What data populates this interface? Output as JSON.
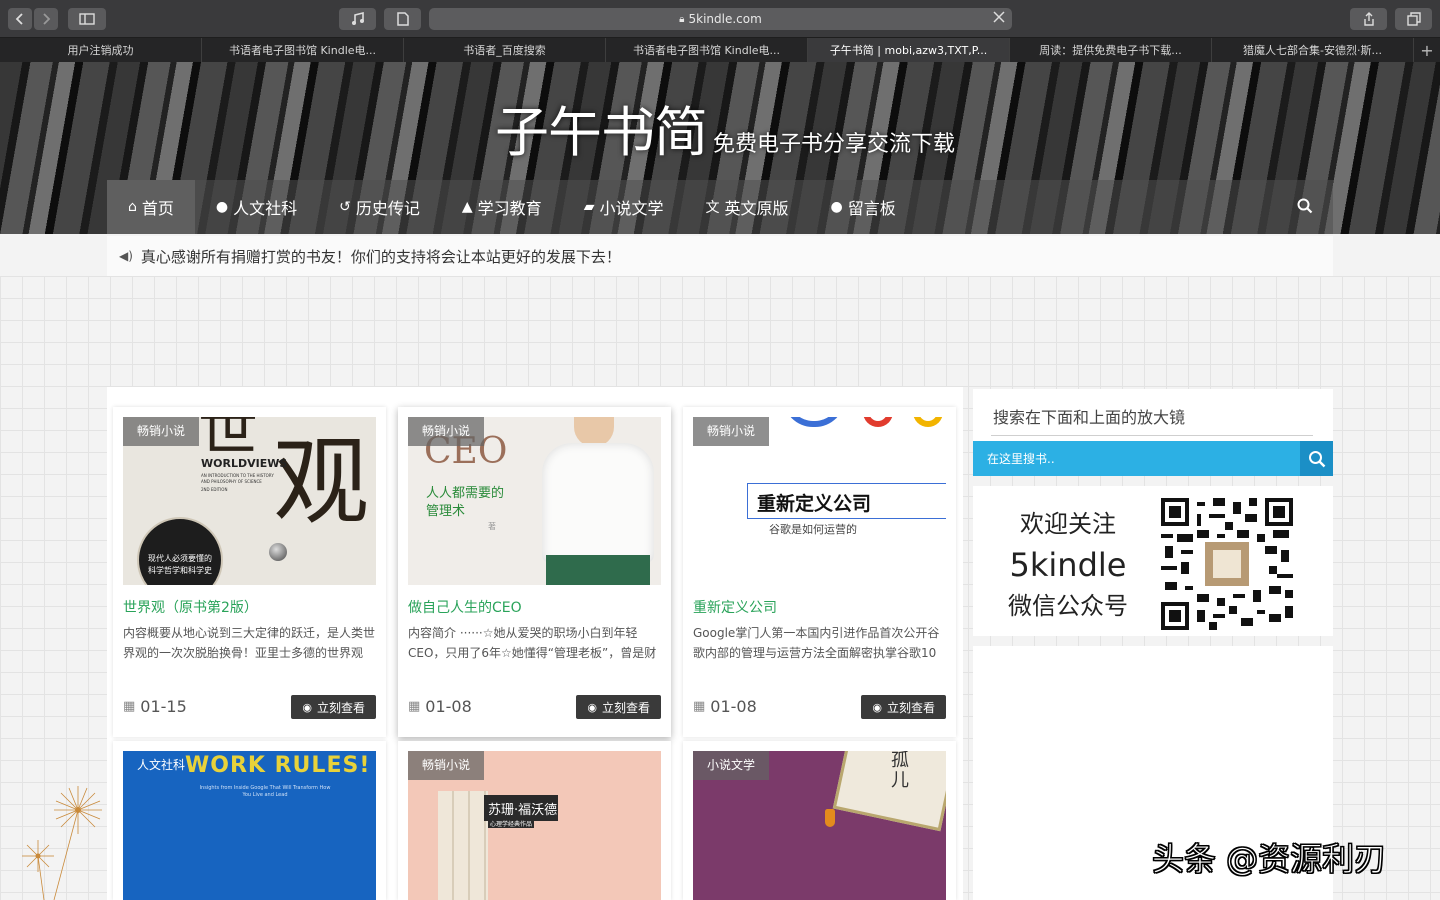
{
  "browser": {
    "url": "5kindle.com",
    "tabs": [
      {
        "label": "用户注销成功",
        "active": false
      },
      {
        "label": "书语者电子图书馆 Kindle电...",
        "active": false
      },
      {
        "label": "书语者_百度搜索",
        "active": false
      },
      {
        "label": "书语者电子图书馆 Kindle电...",
        "active": false
      },
      {
        "label": "子午书简 | mobi,azw3,TXT,P...",
        "active": true
      },
      {
        "label": "周读：提供免费电子书下载...",
        "active": false
      },
      {
        "label": "猎魔人七部合集-安德烈·斯...",
        "active": false
      }
    ],
    "new_tab": "+"
  },
  "site": {
    "logo_main": "子午书简",
    "logo_sub": "免费电子书分享交流下载"
  },
  "nav": {
    "items": [
      {
        "label": "首页",
        "icon": "home-icon",
        "glyph": "⌂"
      },
      {
        "label": "人文社科",
        "icon": "globe-icon",
        "glyph": "●"
      },
      {
        "label": "历史传记",
        "icon": "history-icon",
        "glyph": "↺"
      },
      {
        "label": "学习教育",
        "icon": "graduation-cap-icon",
        "glyph": "▲"
      },
      {
        "label": "小说文学",
        "icon": "book-icon",
        "glyph": "▰"
      },
      {
        "label": "英文原版",
        "icon": "translate-icon",
        "glyph": "文"
      },
      {
        "label": "留言板",
        "icon": "message-icon",
        "glyph": "●"
      }
    ]
  },
  "notice": {
    "text": "真心感谢所有捐赠打赏的书友！你们的支持将会让本站更好的发展下去！"
  },
  "posts": [
    {
      "badge": "畅销小说",
      "title": "世界观（原书第2版）",
      "desc": "内容概要从地心说到三大定律的跃迁，是人类世界观的一次次脱胎换骨！亚里士多德的世界观",
      "date": "01-15",
      "button": "立刻查看",
      "cover_big": "观",
      "cover_small": "世",
      "cover_en": "WORLDVIEWS",
      "cover_en_sub": "AN INTRODUCTION TO THE HISTORY AND PHILOSOPHY OF SCIENCE",
      "cover_edition": "2ND EDITION",
      "cover_circle": "现代人必须要懂的科学哲学和科学史"
    },
    {
      "badge": "畅销小说",
      "title": "做自己人生的CEO",
      "desc": "内容简介 ······☆她从爱哭的职场小白到年轻CEO，只用了6年☆她懂得“管理老板”，曾是财",
      "date": "01-08",
      "button": "立刻查看",
      "cover_big": "CEO",
      "cover_sub": "人人都需要的管理术",
      "cover_author": "著"
    },
    {
      "badge": "畅销小说",
      "title": "重新定义公司",
      "desc": "Google掌门人第一本国内引进作品首次公开谷歌内部的管理与运营方法全面解密执掌谷歌10",
      "date": "01-08",
      "button": "立刻查看",
      "cover_title": "重新定义公司",
      "cover_sub": "谷歌是如何运营的"
    }
  ],
  "posts_row2": [
    {
      "badge": "人文社科",
      "cover_title": "WORK RULES!",
      "cover_sub": "Insights from Inside Google That Will Transform How You Live and Lead"
    },
    {
      "badge": "畅销小说",
      "cover_title": "苏珊·福沃德",
      "cover_sub": "心理学经典作品"
    },
    {
      "badge": "小说文学",
      "cover_title": "孤儿"
    }
  ],
  "sidebar": {
    "search_title": "搜索在下面和上面的放大镜",
    "search_placeholder": "在这里搜书..",
    "wechat_line1": "欢迎关注",
    "wechat_line2": "5kindle",
    "wechat_line3": "微信公众号"
  },
  "watermark": "头条 @资源利刃",
  "colors": {
    "accent_green": "#2aa35a",
    "search_blue": "#2cb0e4",
    "search_btn": "#1b8fc6"
  }
}
